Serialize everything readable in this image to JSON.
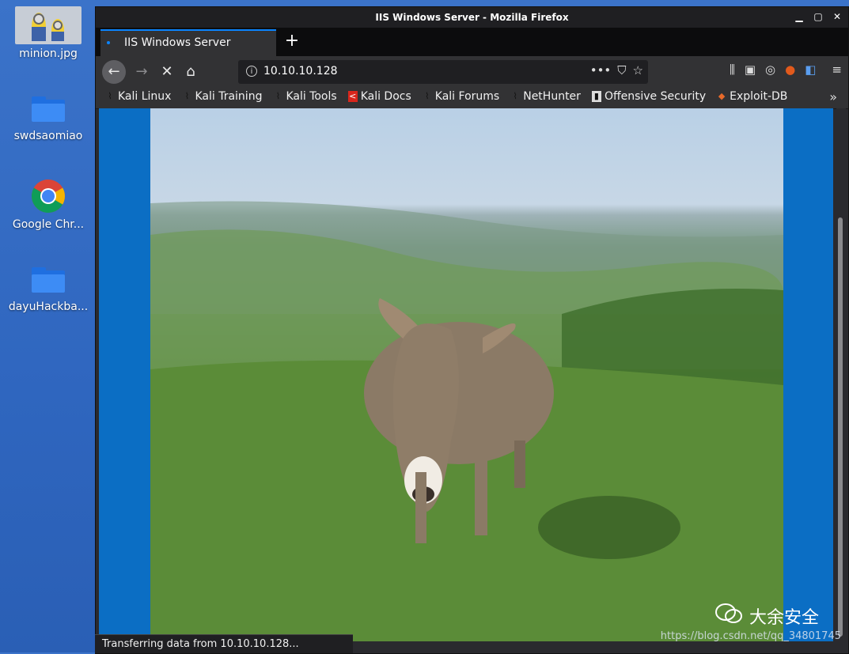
{
  "desktop": {
    "icons": [
      {
        "label": "minion.jpg"
      },
      {
        "label": "swdsaomiao"
      },
      {
        "label": "Google Chr..."
      },
      {
        "label": "dayuHackba..."
      }
    ]
  },
  "window": {
    "title": "IIS Windows Server - Mozilla Firefox",
    "tab_label": "IIS Windows Server",
    "url": "10.10.10.128",
    "bookmarks": [
      {
        "label": "Kali Linux"
      },
      {
        "label": "Kali Training"
      },
      {
        "label": "Kali Tools"
      },
      {
        "label": "Kali Docs"
      },
      {
        "label": "Kali Forums"
      },
      {
        "label": "NetHunter"
      },
      {
        "label": "Offensive Security"
      },
      {
        "label": "Exploit-DB"
      }
    ],
    "status_text": "Transferring data from 10.10.10.128...",
    "content_bg": "#0b6ec4"
  },
  "watermark": {
    "brand": "大余安全",
    "url": "https://blog.csdn.net/qq_34801745"
  }
}
